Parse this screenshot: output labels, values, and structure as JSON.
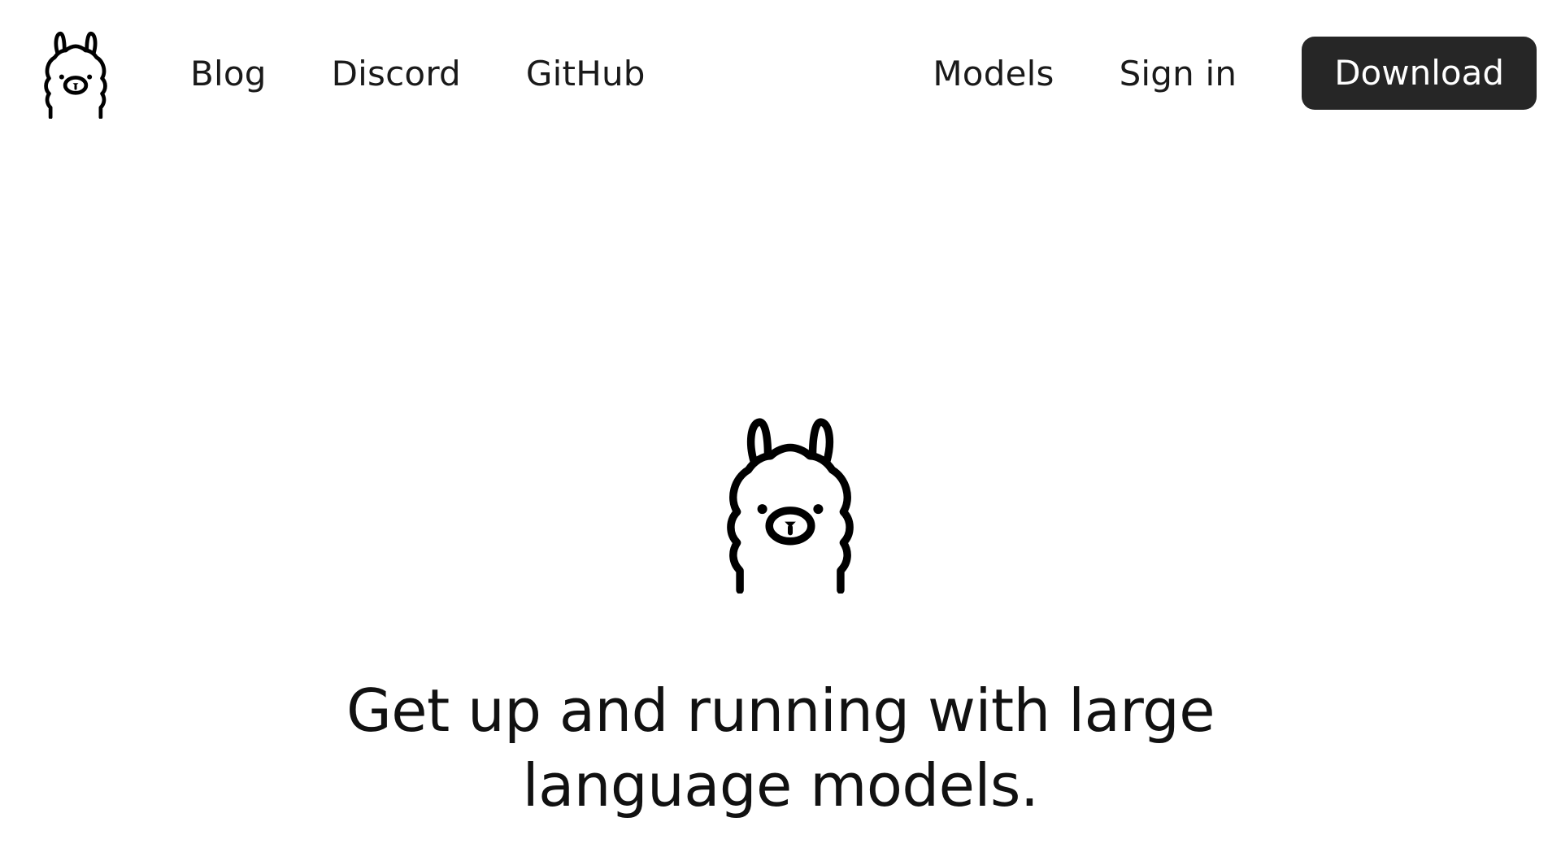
{
  "brand": {
    "logo_icon": "llama-icon",
    "accent_color": "#262626",
    "text_color": "#1a1a1a",
    "background_color": "#ffffff"
  },
  "nav": {
    "left_links": [
      {
        "label": "Blog"
      },
      {
        "label": "Discord"
      },
      {
        "label": "GitHub"
      }
    ],
    "models_label": "Models",
    "signin_label": "Sign in",
    "download_label": "Download"
  },
  "hero": {
    "icon": "llama-icon",
    "tagline_line1": "Get up and running with large",
    "tagline_line2": "language models."
  }
}
